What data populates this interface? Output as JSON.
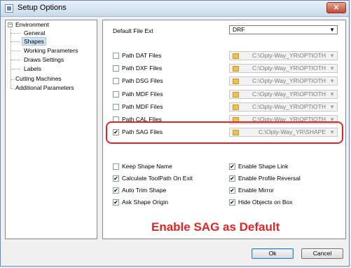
{
  "window": {
    "title": "Setup Options",
    "close_glyph": "✕"
  },
  "tree": {
    "root_label": "Environment",
    "root_expander": "−",
    "children": [
      "General",
      "Shapes",
      "Working Parameters",
      "Draws Settings",
      "Labels"
    ],
    "selected": "Shapes",
    "cutting_machines": "Cutting Machines",
    "additional_parameters": "Additional Parameters"
  },
  "default_ext": {
    "label": "Default File Ext",
    "value": "DRF"
  },
  "paths": [
    {
      "label": "Path DAT Files",
      "checked": false,
      "value": "C:\\Opty-Way_YR\\OPTIOTH"
    },
    {
      "label": "Path DXF Files",
      "checked": false,
      "value": "C:\\Opty-Way_YR\\OPTIOTH"
    },
    {
      "label": "Path DSG Files",
      "checked": false,
      "value": "C:\\Opty-Way_YR\\OPTIOTH"
    },
    {
      "label": "Path MDF Files",
      "checked": false,
      "value": "C:\\Opty-Way_YR\\OPTIOTH"
    },
    {
      "label": "Path MDF Files",
      "checked": false,
      "value": "C:\\Opty-Way_YR\\OPTIOTH"
    },
    {
      "label": "Path CAL FIles",
      "checked": false,
      "value": "C:\\Opty-Way_YR\\OPTIOTH"
    },
    {
      "label": "Path SAG Files",
      "checked": true,
      "value": "C:\\Opty-Way_YR\\SHAPE"
    }
  ],
  "options_left": [
    {
      "label": "Keep Shape Name",
      "checked": false
    },
    {
      "label": "Calculate ToolPath On Exit",
      "checked": true
    },
    {
      "label": "Auto Trim Shape",
      "checked": true
    },
    {
      "label": "Ask Shape Origin",
      "checked": true
    }
  ],
  "options_right": [
    {
      "label": "Enable Shape Link",
      "checked": true
    },
    {
      "label": "Enable Profile Reversal",
      "checked": true
    },
    {
      "label": "Enable Mirror",
      "checked": true
    },
    {
      "label": "Hide Objects on Box",
      "checked": true
    }
  ],
  "buttons": {
    "ok": "Ok",
    "cancel": "Cancel"
  },
  "annotation": {
    "text": "Enable SAG as Default",
    "color": "#e02424"
  },
  "icons": {
    "check": "✔",
    "dropdown": "▼",
    "folder": "folder-icon"
  }
}
